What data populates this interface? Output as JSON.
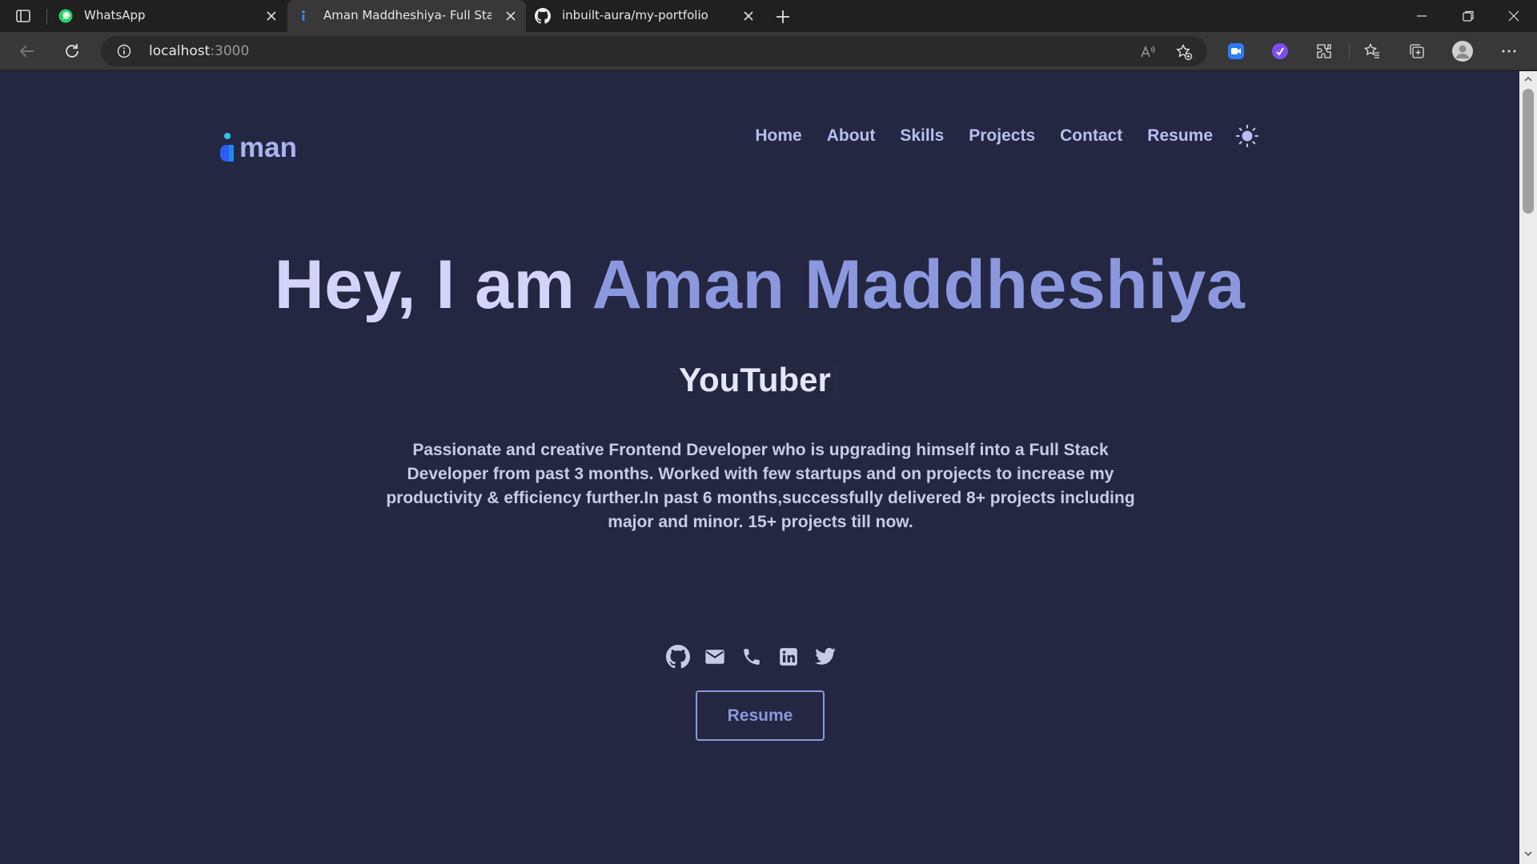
{
  "browser": {
    "tabs": [
      {
        "title": "WhatsApp",
        "icon": "whatsapp-icon"
      },
      {
        "title": "Aman Maddheshiya- Full Stack W",
        "icon": "portfolio-favicon-icon",
        "active": true
      },
      {
        "title": "inbuilt-aura/my-portfolio",
        "icon": "github-icon"
      }
    ],
    "address": {
      "host": "localhost",
      "port": ":3000"
    },
    "accent": "#383838"
  },
  "site": {
    "logo_text": "man",
    "nav": [
      "Home",
      "About",
      "Skills",
      "Projects",
      "Contact",
      "Resume"
    ],
    "theme_icon": "sun-icon"
  },
  "hero": {
    "greeting": "Hey, I am",
    "name": "Aman Maddheshiya",
    "role": "YouTuber",
    "bio": "Passionate and creative Frontend Developer who is upgrading himself into a Full Stack Developer from past 3 months. Worked with few startups and on projects to increase my productivity & efficiency further.In past 6 months,successfully delivered 8+ projects including major and minor. 15+ projects till now.",
    "socials": [
      "github-icon",
      "mail-icon",
      "phone-icon",
      "linkedin-icon",
      "twitter-icon"
    ],
    "resume_label": "Resume"
  },
  "colors": {
    "page_bg": "#232741",
    "accent": "#8c98de",
    "greeting": "#d4d4fb"
  }
}
